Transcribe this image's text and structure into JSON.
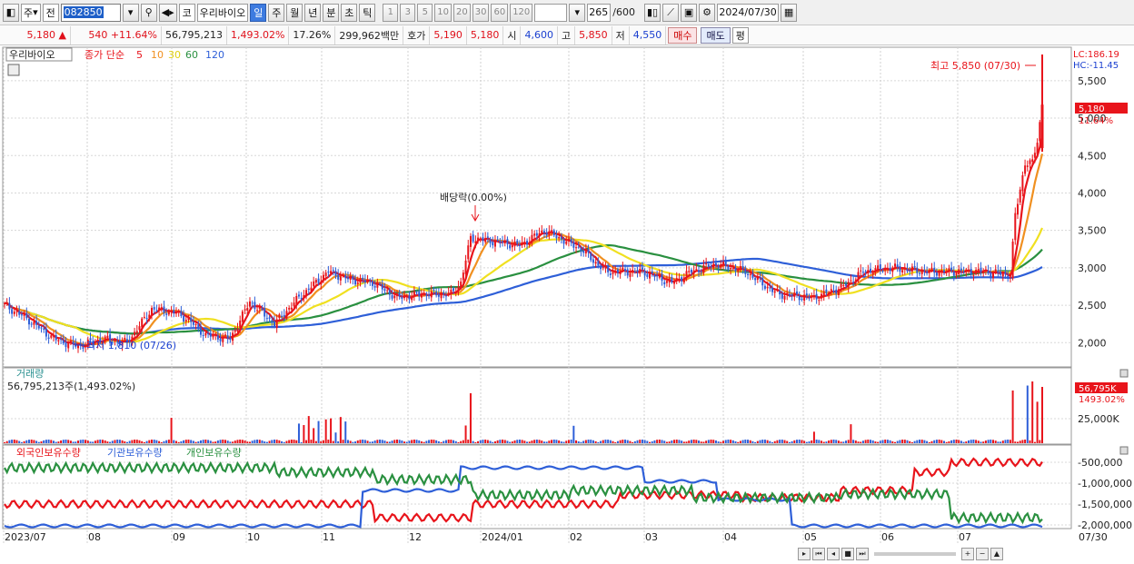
{
  "toolbar": {
    "market": "주",
    "prefix": "전",
    "code": "082850",
    "stock_prefix": "코",
    "stock_name": "우리바이오",
    "periods": [
      "일",
      "주",
      "월",
      "년",
      "분",
      "초",
      "틱"
    ],
    "active_period": "일",
    "intervals": [
      "1",
      "3",
      "5",
      "10",
      "20",
      "30",
      "60",
      "120"
    ],
    "count": "265",
    "count_max": "/600",
    "date": "2024/07/30"
  },
  "info": {
    "price": "5,180",
    "change": "540",
    "change_pct": "+11.64%",
    "volume": "56,795,213",
    "volume_pct": "1,493.02%",
    "turnover": "17.26%",
    "amount": "299,962백만",
    "ask_label": "호가",
    "ask1": "5,190",
    "ask2": "5,180",
    "open_label": "시",
    "open": "4,600",
    "high_label": "고",
    "high": "5,850",
    "low_label": "저",
    "low": "4,550",
    "buy": "매수",
    "sell": "매도",
    "flat": "평"
  },
  "legend": {
    "stock": "우리바이오",
    "ma_label": "종가 단순",
    "ma_periods": [
      "5",
      "10",
      "30",
      "60",
      "120"
    ],
    "ma_colors": [
      "#e8141b",
      "#f09020",
      "#f0e020",
      "#2a9040",
      "#2e5fd8"
    ]
  },
  "annotations": {
    "high": "최고 5,850 (07/30)",
    "low": "최저 1,810 (07/26)",
    "dividend": "배당락(0.00%)",
    "lc": "LC:186.19",
    "hc": "HC:-11.45",
    "price_tag": "5,180",
    "pct_tag": "11.64%"
  },
  "volume_panel": {
    "title": "거래량",
    "subtitle": "56,795,213주(1,493.02%)",
    "tag": "56,795K",
    "pct_tag": "1493.02%"
  },
  "holdings_panel": {
    "labels": [
      "외국인보유수량",
      "기관보유수량",
      "개인보유수량"
    ],
    "colors": [
      "#e8141b",
      "#2e5fd8",
      "#2a9040"
    ]
  },
  "chart_data": {
    "type": "candlestick",
    "x_labels": [
      "2023/07",
      "08",
      "09",
      "10",
      "11",
      "12",
      "2024/01",
      "02",
      "03",
      "04",
      "05",
      "06",
      "07",
      "07/30"
    ],
    "price_axis": [
      "5,500",
      "5,000",
      "4,500",
      "4,000",
      "3,500",
      "3,000",
      "2,500",
      "2,000"
    ],
    "price_ticks": [
      5500,
      5000,
      4500,
      4000,
      3500,
      3000,
      2500,
      2000
    ],
    "price_range": [
      1700,
      5850
    ],
    "volume_axis": [
      "25,000K"
    ],
    "holdings_axis": [
      "-500,000",
      "-1,000,000",
      "-1,500,000",
      "-2,000,000"
    ],
    "close_keypoints": [
      [
        0,
        2500
      ],
      [
        10,
        2300
      ],
      [
        20,
        2050
      ],
      [
        30,
        1950
      ],
      [
        40,
        2050
      ],
      [
        50,
        2000
      ],
      [
        60,
        2450
      ],
      [
        70,
        2400
      ],
      [
        75,
        2300
      ],
      [
        82,
        2100
      ],
      [
        92,
        2050
      ],
      [
        100,
        2550
      ],
      [
        110,
        2250
      ],
      [
        120,
        2600
      ],
      [
        132,
        2950
      ],
      [
        140,
        2850
      ],
      [
        150,
        2800
      ],
      [
        160,
        2600
      ],
      [
        170,
        2650
      ],
      [
        182,
        2650
      ],
      [
        186,
        2800
      ],
      [
        190,
        3400
      ],
      [
        200,
        3350
      ],
      [
        210,
        3300
      ],
      [
        220,
        3500
      ],
      [
        235,
        3250
      ],
      [
        245,
        2950
      ],
      [
        260,
        2950
      ],
      [
        272,
        2800
      ],
      [
        280,
        2950
      ],
      [
        290,
        3050
      ],
      [
        302,
        2950
      ],
      [
        315,
        2650
      ],
      [
        330,
        2600
      ],
      [
        342,
        2750
      ],
      [
        350,
        2950
      ],
      [
        362,
        3000
      ],
      [
        375,
        2950
      ],
      [
        390,
        2950
      ],
      [
        400,
        2950
      ],
      [
        410,
        2900
      ],
      [
        412,
        3700
      ],
      [
        416,
        4400
      ],
      [
        419,
        4400
      ],
      [
        421,
        4700
      ],
      [
        423,
        5180
      ]
    ],
    "high": "5,850",
    "low": "1,810",
    "last_close": "5,180"
  }
}
